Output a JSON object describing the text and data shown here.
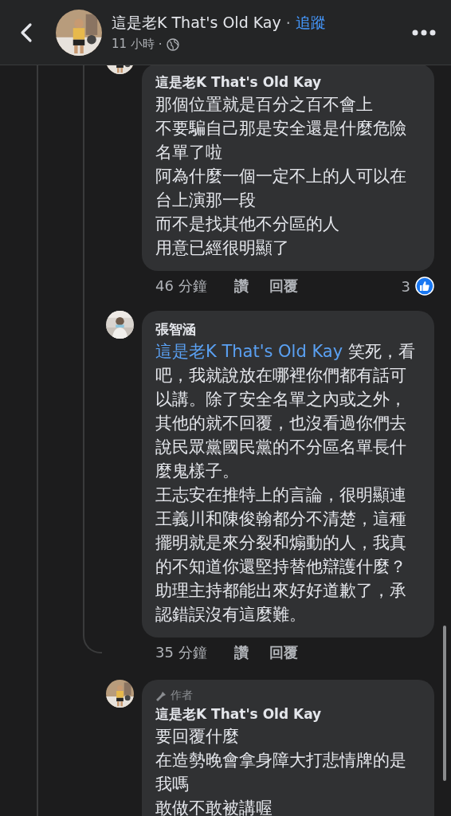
{
  "header": {
    "name": "這是老K  That's Old Kay",
    "separator": "·",
    "follow": "追蹤",
    "time": "11 小時",
    "time_separator": "·"
  },
  "comments": [
    {
      "author": "這是老K  That's Old Kay",
      "text": [
        "那個位置就是百分之百不會上",
        "不要騙自己那是安全還是什麼危險名單了啦",
        "阿為什麼一個一定不上的人可以在台上演那一段",
        "而不是找其他不分區的人",
        "用意已經很明顯了"
      ],
      "time": "46 分鐘",
      "like": "讚",
      "reply": "回覆",
      "reaction_count": "3"
    },
    {
      "author": "張智涵",
      "mention": "這是老K  That's Old Kay",
      "text": [
        " 笑死，看吧，我就說放在哪裡你們都有話可以講。除了安全名單之內或之外，其他的就不回覆，也沒看過你們去說民眾黨國民黨的不分區名單長什麼鬼樣子。",
        "王志安在推特上的言論，很明顯連王義川和陳俊翰都分不清楚，這種擺明就是來分裂和煽動的人，我真的不知道你還堅持替他辯護什麼？助理主持都能出來好好道歉了，承認錯誤沒有這麼難。"
      ],
      "time": "35 分鐘",
      "like": "讚",
      "reply": "回覆"
    },
    {
      "badge": "作者",
      "author": "這是老K  That's Old Kay",
      "text": [
        "要回覆什麼",
        "在造勢晚會拿身障大打悲情牌的是我嗎",
        "敢做不敢被講喔"
      ]
    }
  ]
}
